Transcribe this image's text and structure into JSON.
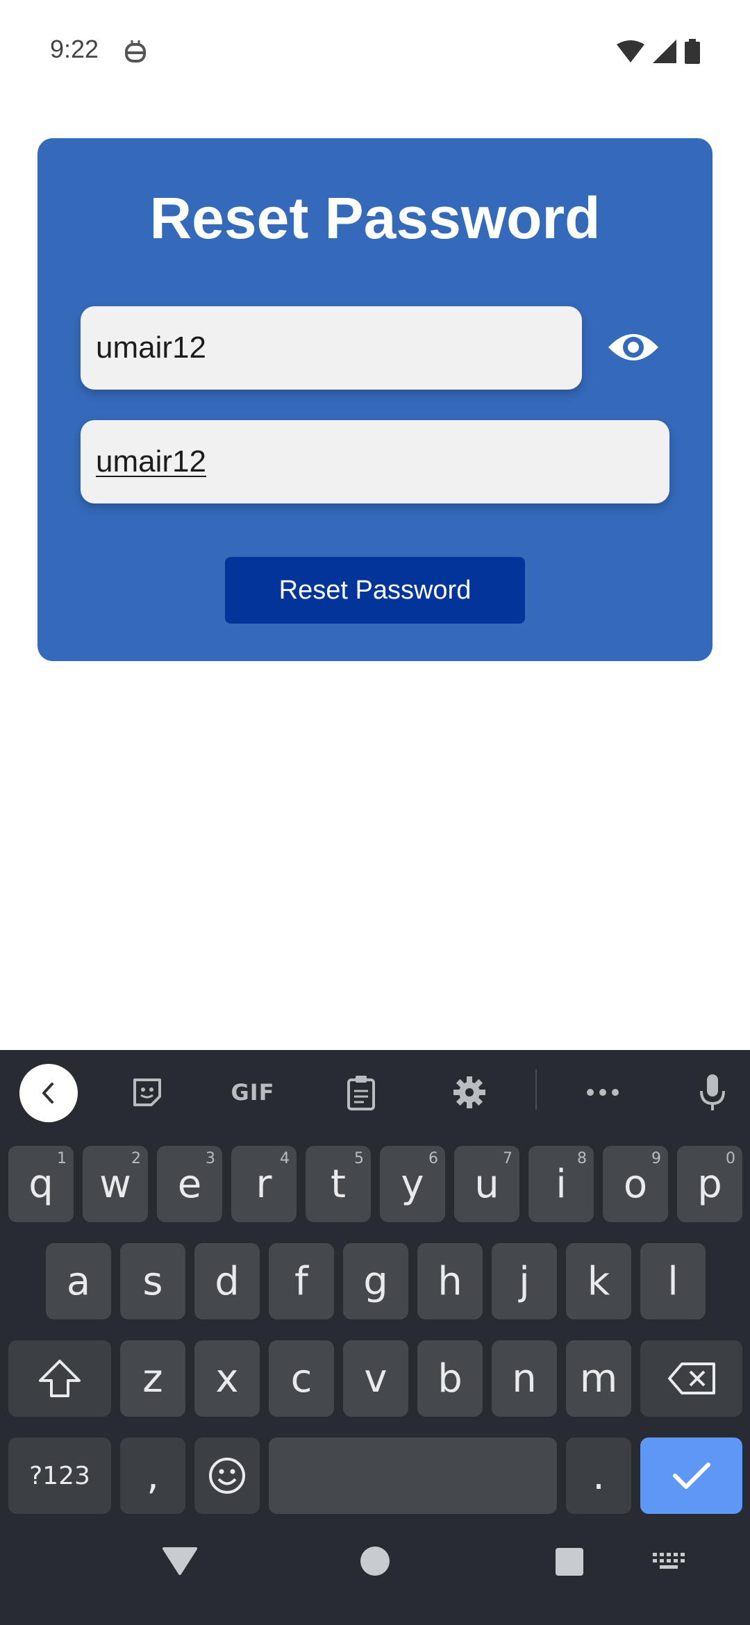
{
  "status_bar": {
    "time": "9:22",
    "icons": [
      "robot-icon",
      "wifi-icon",
      "signal-icon",
      "battery-icon"
    ]
  },
  "card": {
    "title": "Reset Password",
    "password_field": {
      "value": "umair12"
    },
    "confirm_field": {
      "value": "umair12"
    },
    "toggle_visibility_icon": "eye-icon",
    "button_label": "Reset Password"
  },
  "keyboard": {
    "toolbar": {
      "back": "chevron-left-icon",
      "sticker": "sticker-icon",
      "gif_label": "GIF",
      "clipboard": "clipboard-icon",
      "settings": "gear-icon",
      "more": "more-icon",
      "mic": "mic-icon"
    },
    "row1": [
      {
        "key": "q",
        "hint": "1"
      },
      {
        "key": "w",
        "hint": "2"
      },
      {
        "key": "e",
        "hint": "3"
      },
      {
        "key": "r",
        "hint": "4"
      },
      {
        "key": "t",
        "hint": "5"
      },
      {
        "key": "y",
        "hint": "6"
      },
      {
        "key": "u",
        "hint": "7"
      },
      {
        "key": "i",
        "hint": "8"
      },
      {
        "key": "o",
        "hint": "9"
      },
      {
        "key": "p",
        "hint": "0"
      }
    ],
    "row2": [
      "a",
      "s",
      "d",
      "f",
      "g",
      "h",
      "j",
      "k",
      "l"
    ],
    "row3": [
      "z",
      "x",
      "c",
      "v",
      "b",
      "n",
      "m"
    ],
    "row4": {
      "symbols": "?123",
      "comma": ",",
      "period": "."
    }
  },
  "colors": {
    "card_bg": "#356abb",
    "button_bg": "#03349a",
    "keyboard_bg": "#282b31",
    "key_bg": "#45484d",
    "enter_bg": "#5e97f6"
  }
}
